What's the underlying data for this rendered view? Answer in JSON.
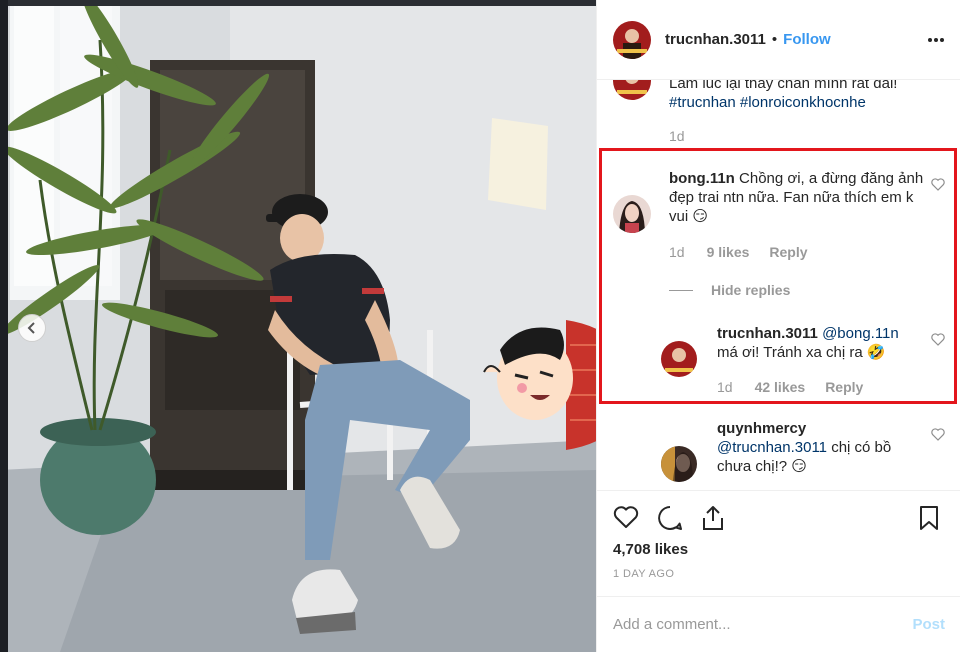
{
  "post": {
    "username": "trucnhan.3011",
    "follow_label": "Follow",
    "dot": "•"
  },
  "comments": {
    "caption_partial": "Lâm lúc lại thấy chân mình rất dài!",
    "caption_tags": "#trucnhan #lonroiconkhocnhe",
    "caption_time": "1d",
    "c1": {
      "user": "bong.11n",
      "text": "Chồng ơi, a đừng đăng ảnh đẹp trai ntn nữa. Fan nữa thích em k vui 😏",
      "time": "1d",
      "likes": "9 likes",
      "reply": "Reply"
    },
    "hide_replies": "Hide replies",
    "reply1": {
      "user": "trucnhan.3011",
      "mention": "@bong.11n",
      "text": "má ơi! Tránh xa chị ra 🤣",
      "time": "1d",
      "likes": "42 likes",
      "reply": "Reply"
    },
    "c2": {
      "user": "quynhmercy",
      "mention": "@trucnhan.3011",
      "text": " chị có bồ chưa chị!? 😏"
    }
  },
  "actions": {
    "likes": "4,708 likes",
    "date": "1 DAY AGO"
  },
  "add_comment": {
    "placeholder": "Add a comment...",
    "post_label": "Post"
  },
  "colors": {
    "accent": "#3897f0",
    "highlight": "#e3161c",
    "muted": "#999999"
  },
  "icons": [
    "chevron-left-icon",
    "more-icon",
    "heart-icon",
    "comment-icon",
    "share-icon",
    "bookmark-icon"
  ]
}
